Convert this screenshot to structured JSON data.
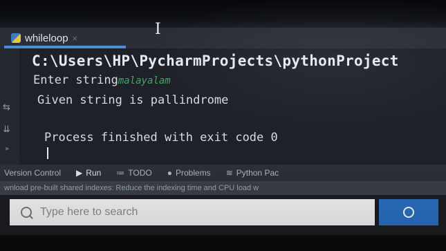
{
  "editor_tab": {
    "label": "whileloop",
    "close_glyph": "×"
  },
  "console": {
    "path_line": "C:\\Users\\HP\\PycharmProjects\\pythonProject",
    "prompt": "Enter string",
    "typed_input": "malayalam",
    "result_line": "Given string is pallindrome",
    "exit_line": "Process finished with exit code 0"
  },
  "gutter_icons": [
    "soft-wrap-icon",
    "scroll-to-end-icon",
    "more-icon"
  ],
  "tool_windows": [
    {
      "label": "Version Control",
      "icon": ""
    },
    {
      "label": "Run",
      "icon": "▶"
    },
    {
      "label": "TODO",
      "icon": "≔"
    },
    {
      "label": "Problems",
      "icon": "●"
    },
    {
      "label": "Python Pac",
      "icon": "≋"
    }
  ],
  "status_bar": {
    "text": "wnload pre-built shared indexes: Reduce the indexing time and CPU load w"
  },
  "taskbar": {
    "search_placeholder": "Type here to search"
  },
  "colors": {
    "accent": "#4a8cd8",
    "input_text": "#47a36b",
    "taskbar_button": "#2b6fc1"
  }
}
